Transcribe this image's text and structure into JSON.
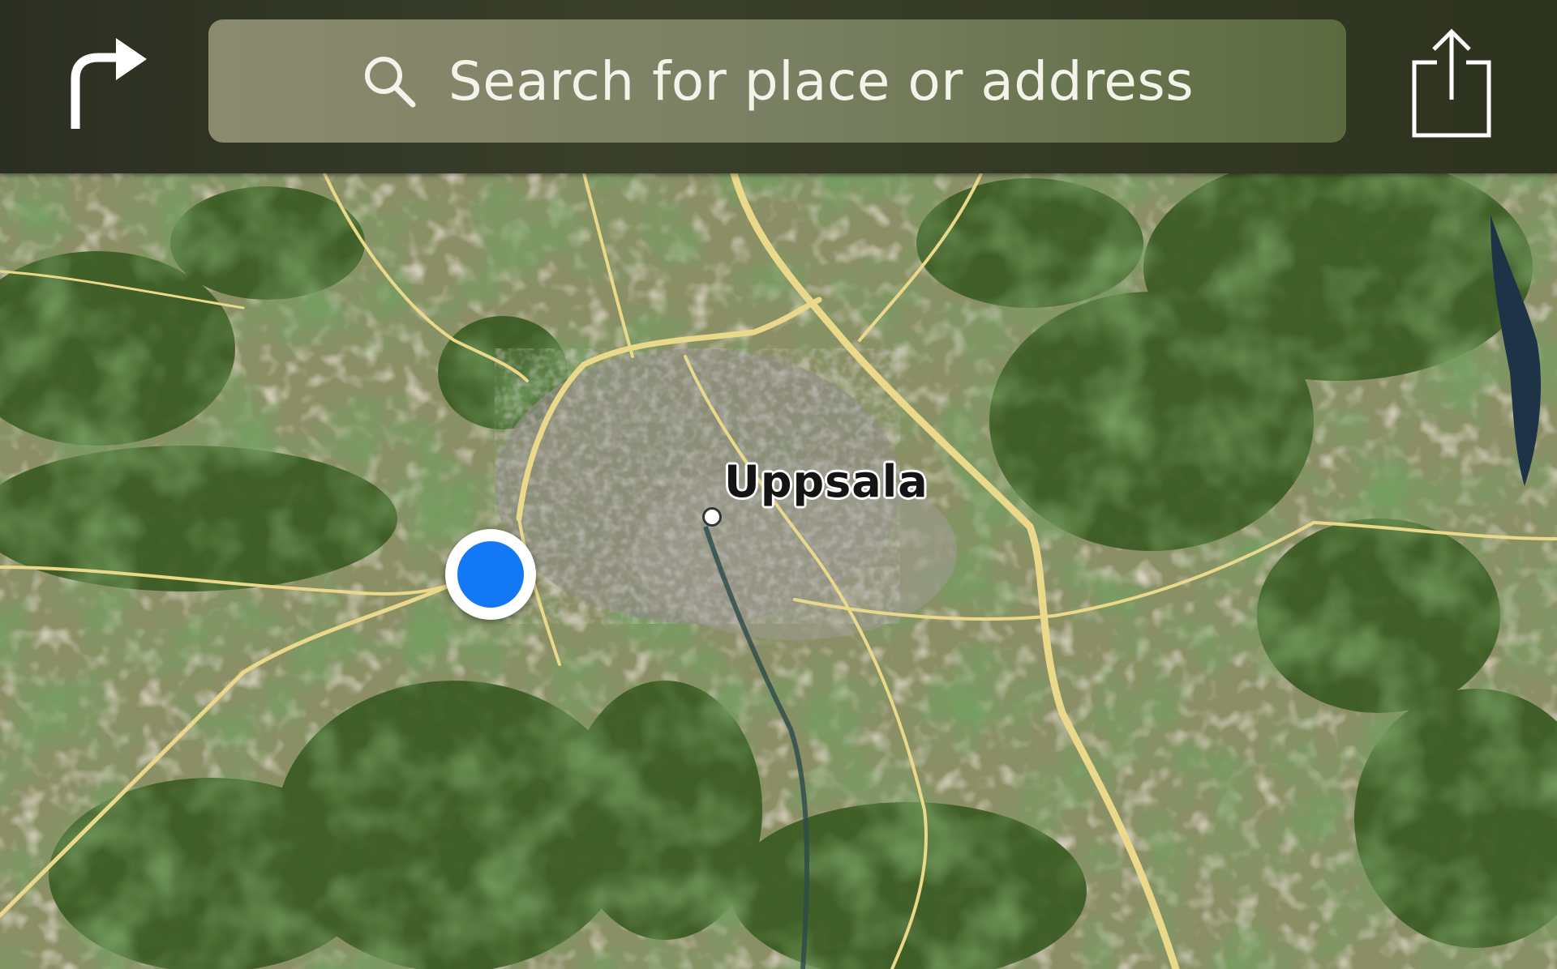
{
  "toolbar": {
    "search_placeholder": "Search for place or address",
    "directions_icon": "turn-right-arrow-icon",
    "search_icon": "magnifier-icon",
    "share_icon": "share-icon"
  },
  "map": {
    "view": "satellite",
    "city_label": "Uppsala"
  },
  "colors": {
    "user_location": "#1278f5",
    "road": "#e8d98a"
  }
}
